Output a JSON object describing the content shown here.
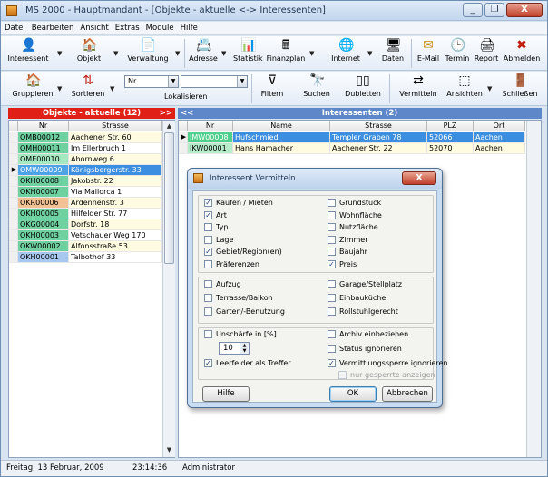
{
  "window": {
    "title": "IMS 2000 - Hauptmandant - [Objekte - aktuelle <-> Interessenten]",
    "minimize": "_",
    "restore": "❐",
    "close": "X"
  },
  "menu": [
    "Datei",
    "Bearbeiten",
    "Ansicht",
    "Extras",
    "Module",
    "Hilfe"
  ],
  "toolbar1": [
    {
      "label": "Interessent",
      "icon": "person-icon",
      "glyph": "👤"
    },
    {
      "label": "Objekt",
      "icon": "house-icon",
      "glyph": "🏠"
    },
    {
      "label": "Verwaltung",
      "icon": "document-icon",
      "glyph": "📄"
    },
    {
      "label": "Adresse",
      "icon": "address-book-icon",
      "glyph": "📇"
    },
    {
      "label": "Statistik",
      "icon": "statistic-icon",
      "glyph": "📊"
    },
    {
      "label": "Finanzplan",
      "icon": "calculator-icon",
      "glyph": "🖩"
    },
    {
      "label": "Internet",
      "icon": "globe-icon",
      "glyph": "🌐"
    },
    {
      "label": "Daten",
      "icon": "computer-icon",
      "glyph": "🖥"
    },
    {
      "label": "E-Mail",
      "icon": "envelope-icon",
      "glyph": "✉"
    },
    {
      "label": "Termin",
      "icon": "clock-icon",
      "glyph": "🕒"
    },
    {
      "label": "Report",
      "icon": "printer-icon",
      "glyph": "🖨"
    },
    {
      "label": "Abmelden",
      "icon": "logout-x-icon",
      "glyph": "✖"
    }
  ],
  "toolbar2": {
    "gruppieren": "Gruppieren",
    "sortieren": "Sortieren",
    "sort_field": "Nr",
    "lokalisieren": "Lokalisieren",
    "filtern": "Filtern",
    "suchen": "Suchen",
    "dubletten": "Dubletten",
    "vermitteln": "Vermitteln",
    "ansichten": "Ansichten",
    "schliessen": "Schließen",
    "icons": {
      "group": "🏠",
      "sort": "⇅",
      "filter": "⊽",
      "search": "🔭",
      "dup": "▯▯",
      "mediate": "⇄",
      "views": "⬚",
      "close": "🚪"
    }
  },
  "left_panel": {
    "header": "Objekte - aktuelle (12)",
    "header_arrow": ">>",
    "columns": [
      "Nr",
      "Strasse"
    ],
    "rows": [
      {
        "nr": "OMB00012",
        "strasse": "Aachener Str. 60",
        "nrcolor": "#6fd1a0"
      },
      {
        "nr": "OMH00011",
        "strasse": "Im Ellerbruch 1",
        "nrcolor": "#6fd1a0"
      },
      {
        "nr": "OME00010",
        "strasse": "Ahornweg 6",
        "nrcolor": "#a6e8c0"
      },
      {
        "nr": "OMW00009",
        "strasse": "Königsbergerstr. 33",
        "nrcolor": "#4ea3e6",
        "selected": true
      },
      {
        "nr": "OKH00008",
        "strasse": "Jakobstr. 22",
        "nrcolor": "#6fd1a0"
      },
      {
        "nr": "OKH00007",
        "strasse": "Via Mallorca 1",
        "nrcolor": "#6fd1a0"
      },
      {
        "nr": "OKR00006",
        "strasse": "Ardennenstr. 3",
        "nrcolor": "#f2c294"
      },
      {
        "nr": "OKH00005",
        "strasse": "Hilfelder Str. 77",
        "nrcolor": "#6fd1a0"
      },
      {
        "nr": "OKG00004",
        "strasse": "Dorfstr. 18",
        "nrcolor": "#6fd1a0"
      },
      {
        "nr": "OKH00003",
        "strasse": "Vetschauer Weg 170",
        "nrcolor": "#6fd1a0"
      },
      {
        "nr": "OKW00002",
        "strasse": "Alfonsstraße 53",
        "nrcolor": "#6fd1a0"
      },
      {
        "nr": "OKH00001",
        "strasse": "Talbothof 33",
        "nrcolor": "#a9c8f0"
      }
    ]
  },
  "right_panel": {
    "header": "Interessenten (2)",
    "header_arrow": "<<",
    "columns": [
      "Nr",
      "Name",
      "Strasse",
      "PLZ",
      "Ort"
    ],
    "rows": [
      {
        "nr": "IMW00008",
        "name": "Hufschmied",
        "strasse": "Templer Graben 78",
        "plz": "52066",
        "ort": "Aachen",
        "selected": true
      },
      {
        "nr": "IKW00001",
        "name": "Hans Hamacher",
        "strasse": "Aachener Str. 22",
        "plz": "52070",
        "ort": "Aachen"
      }
    ]
  },
  "status": {
    "date": "Freitag, 13 Februar, 2009",
    "time": "23:14:36",
    "user": "Administrator"
  },
  "dialog": {
    "title": "Interessent Vermitteln",
    "close": "X",
    "group1_left": [
      {
        "label": "Kaufen / Mieten",
        "checked": true
      },
      {
        "label": "Art",
        "checked": true
      },
      {
        "label": "Typ",
        "checked": false
      },
      {
        "label": "Lage",
        "checked": false
      },
      {
        "label": "Gebiet/Region(en)",
        "checked": true
      },
      {
        "label": "Präferenzen",
        "checked": false
      }
    ],
    "group1_right": [
      {
        "label": "Grundstück",
        "checked": false
      },
      {
        "label": "Wohnfläche",
        "checked": false
      },
      {
        "label": "Nutzfläche",
        "checked": false
      },
      {
        "label": "Zimmer",
        "checked": false
      },
      {
        "label": "Baujahr",
        "checked": false
      },
      {
        "label": "Preis",
        "checked": true
      }
    ],
    "group2_left": [
      {
        "label": "Aufzug",
        "checked": false
      },
      {
        "label": "Terrasse/Balkon",
        "checked": false
      },
      {
        "label": "Garten/-Benutzung",
        "checked": false
      }
    ],
    "group2_right": [
      {
        "label": "Garage/Stellplatz",
        "checked": false
      },
      {
        "label": "Einbauküche",
        "checked": false
      },
      {
        "label": "Rollstuhlgerecht",
        "checked": false
      }
    ],
    "unschaerfe": "Unschärfe in [%]",
    "unschaerfe_value": "10",
    "leerfelder": "Leerfelder als Treffer",
    "archiv": "Archiv einbeziehen",
    "status_ign": "Status ignorieren",
    "sperre": "Vermittlungssperre ignorieren",
    "nur_gesperrte": "nur gesperrte anzeigen",
    "hilfe": "Hilfe",
    "ok": "OK",
    "abbrechen": "Abbrechen",
    "check": "✓"
  }
}
